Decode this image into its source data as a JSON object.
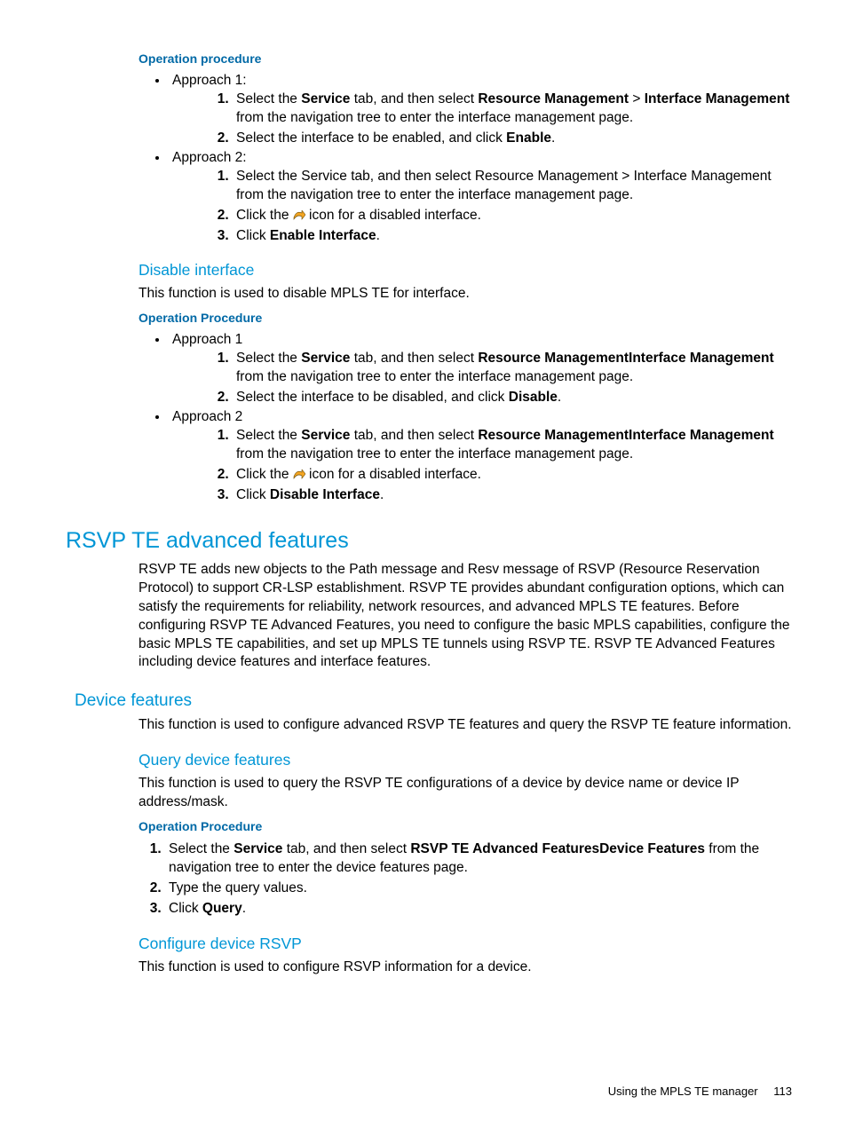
{
  "headings": {
    "op_proc_1": "Operation procedure",
    "disable_iface": "Disable interface",
    "op_proc_2": "Operation Procedure",
    "rsvp_h1": "RSVP TE advanced features",
    "device_features": "Device features",
    "query_dev": "Query device features",
    "op_proc_3": "Operation Procedure",
    "conf_dev_rsvp": "Configure device RSVP"
  },
  "approach": {
    "a1": "Approach 1:",
    "a2": "Approach 2:",
    "b1": "Approach 1",
    "b2": "Approach 2"
  },
  "txt": {
    "sel_the": "Select the ",
    "service": "Service",
    "tab_then_sel": " tab, and then select ",
    "res_mgmt": "Resource Management",
    "gt": " > ",
    "iface_mgmt": "Interface Management",
    "from_nav": " from the navigation tree to enter the interface management page.",
    "sel_iface_enable": "Select the interface to be enabled, and click ",
    "enable": "Enable",
    "period": ".",
    "a2_step1": "Select the Service tab, and then select Resource Management > Interface Management from the navigation tree to enter the interface management page.",
    "click_the": "Click the ",
    "icon_for_disabled": " icon for a disabled interface.",
    "click": "Click ",
    "enable_iface": "Enable Interface",
    "disable_desc": "This function is used to disable MPLS TE for interface.",
    "res_iface_mgmt": "Resource ManagementInterface Management",
    "sel_iface_disable": "Select the interface to be disabled, and click ",
    "disable": "Disable",
    "disable_iface": "Disable Interface",
    "rsvp_para": "RSVP TE adds new objects to the Path message and Resv message of RSVP (Resource Reservation Protocol) to support CR-LSP establishment. RSVP TE provides abundant configuration options, which can satisfy the requirements for reliability, network resources, and advanced MPLS TE features. Before configuring RSVP TE Advanced Features, you need to configure the basic MPLS capabilities, configure the basic MPLS TE capabilities, and set up MPLS TE tunnels using RSVP TE. RSVP TE Advanced Features including device features and interface features.",
    "dev_feat_desc": "This function is used to configure advanced RSVP TE features and query the RSVP TE feature information.",
    "query_desc": "This function is used to query the RSVP TE configurations of a device by device name or device IP address/mask.",
    "rsvp_adv_dev": "RSVP TE Advanced FeaturesDevice Features",
    "from_nav_dev": " from the navigation tree to enter the device features page.",
    "type_qv": "Type the query values.",
    "query": "Query",
    "conf_dev_desc": "This function is used to configure RSVP information for a device."
  },
  "footer": {
    "label": "Using the MPLS TE manager",
    "page": "113"
  }
}
